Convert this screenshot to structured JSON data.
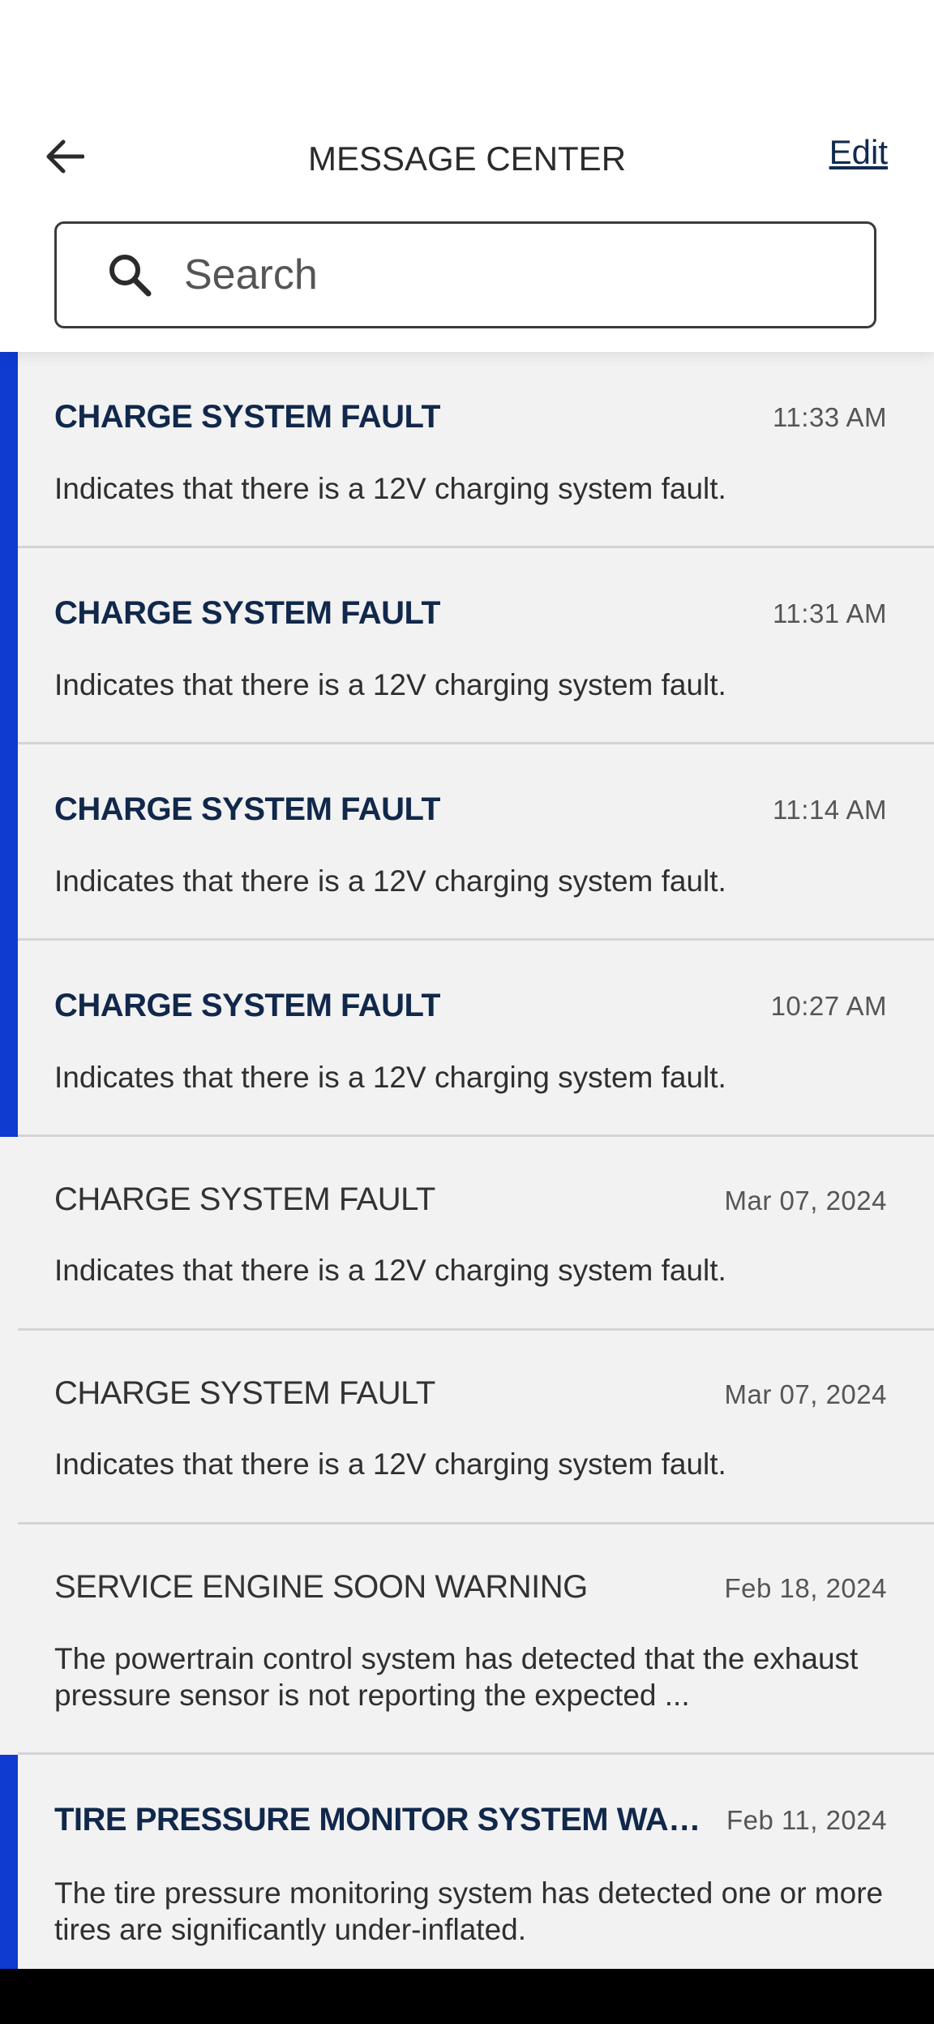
{
  "header": {
    "title": "MESSAGE CENTER",
    "edit_label": "Edit",
    "back_icon": "arrow-left-icon"
  },
  "search": {
    "placeholder": "Search",
    "value": "",
    "icon": "search-icon"
  },
  "messages": [
    {
      "title": "CHARGE SYSTEM FAULT",
      "time": "11:33 AM",
      "body": "Indicates that there is a 12V charging system fault.",
      "unread": true
    },
    {
      "title": "CHARGE SYSTEM FAULT",
      "time": "11:31 AM",
      "body": "Indicates that there is a 12V charging system fault.",
      "unread": true
    },
    {
      "title": "CHARGE SYSTEM FAULT",
      "time": "11:14 AM",
      "body": "Indicates that there is a 12V charging system fault.",
      "unread": true
    },
    {
      "title": "CHARGE SYSTEM FAULT",
      "time": "10:27 AM",
      "body": "Indicates that there is a 12V charging system fault.",
      "unread": true
    },
    {
      "title": "CHARGE SYSTEM FAULT",
      "time": "Mar 07, 2024",
      "body": "Indicates that there is a 12V charging system fault.",
      "unread": false
    },
    {
      "title": "CHARGE SYSTEM FAULT",
      "time": "Mar 07, 2024",
      "body": "Indicates that there is a 12V charging system fault.",
      "unread": false
    },
    {
      "title": "SERVICE ENGINE SOON WARNING",
      "time": "Feb 18, 2024",
      "body": "The powertrain control system has detected that the exhaust pressure sensor is not reporting the expected ...",
      "unread": false
    },
    {
      "title": "TIRE PRESSURE MONITOR SYSTEM WAR...",
      "time": "Feb 11, 2024",
      "body": "The tire pressure monitoring system has detected one or more tires are significantly under-inflated.",
      "unread": true
    }
  ],
  "colors": {
    "unread_indicator": "#0f3bd1",
    "unread_title": "#11284b",
    "list_background": "#f2f2f3"
  }
}
